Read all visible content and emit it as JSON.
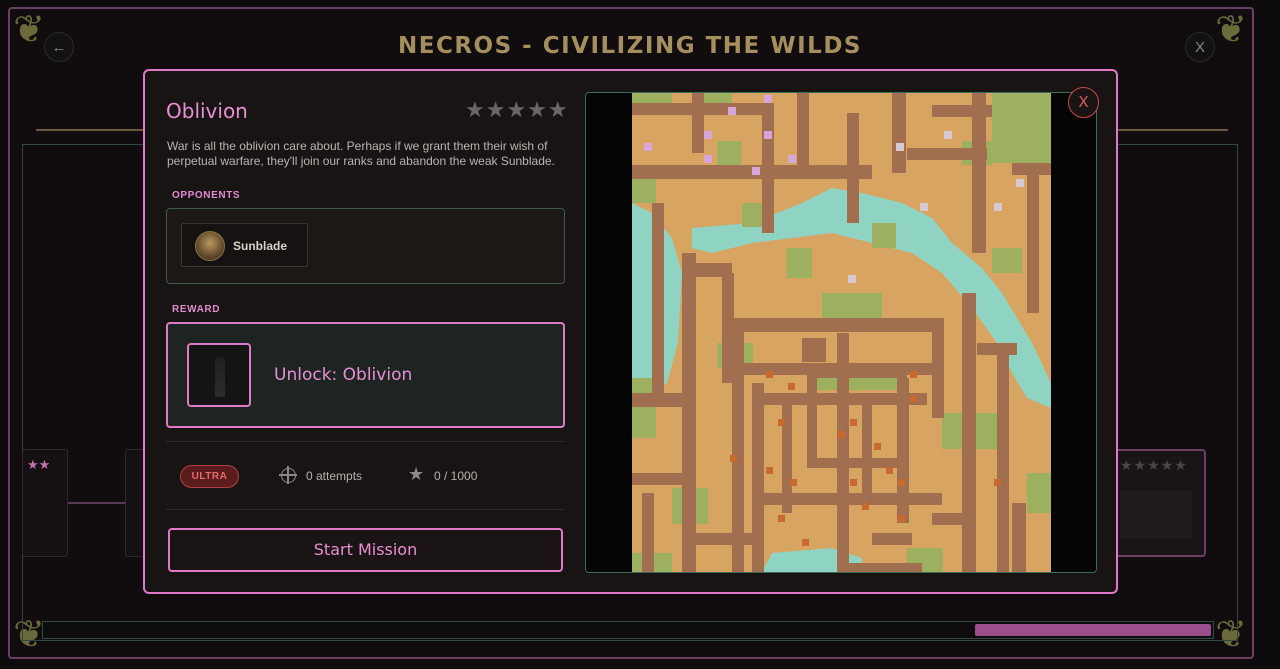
{
  "page": {
    "title": "NECROS - CIVILIZING THE WILDS",
    "back_glyph": "←",
    "close_glyph": "X"
  },
  "modal": {
    "title": "Oblivion",
    "difficulty_stars": "★★★★★",
    "description": "War is all the oblivion care about. Perhaps if we grant them their wish of perpetual warfare, they'll join our ranks and abandon the weak Sunblade.",
    "opponents_label": "OPPONENTS",
    "opponents": [
      {
        "name": "Sunblade"
      }
    ],
    "reward_label": "REWARD",
    "reward_title": "Unlock: Oblivion",
    "badge": "ULTRA",
    "attempts": "0 attempts",
    "score": "0 / 1000",
    "star_glyph": "★",
    "start_button": "Start Mission",
    "close_glyph": "X"
  },
  "background": {
    "left_card_stars": "★★",
    "right_card_stars": "★★★★★"
  },
  "colors": {
    "accent_pink": "#e07ac8",
    "title_gold": "#a68f5e",
    "map_sand": "#d7a561",
    "map_dirt": "#a16e50",
    "map_grass": "#9cb060",
    "map_water": "#8fd4c2"
  },
  "icons": [
    "back-arrow-icon",
    "close-icon",
    "crosshair-icon",
    "star-icon",
    "opponent-avatar",
    "reward-portrait"
  ]
}
